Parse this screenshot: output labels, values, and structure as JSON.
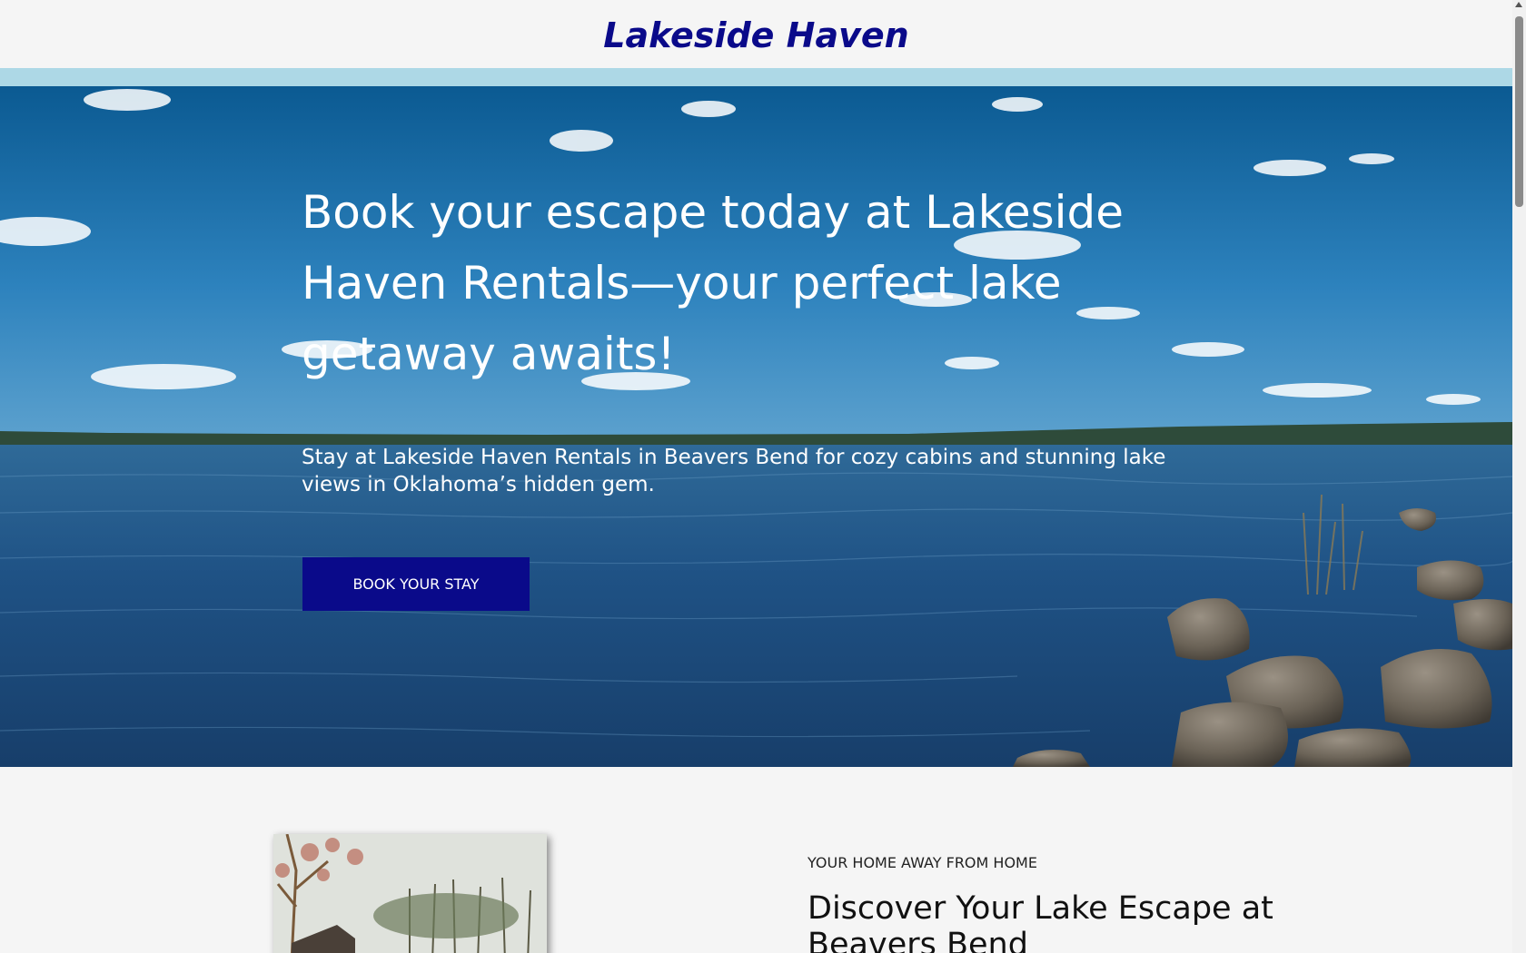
{
  "header": {
    "site_title": "Lakeside Haven"
  },
  "hero": {
    "heading": "Book your escape today at Lakeside Haven Rentals—your perfect lake getaway awaits!",
    "subheading": "Stay at Lakeside Haven Rentals in Beavers Bend for cozy cabins and stunning lake views in Oklahoma’s hidden gem.",
    "cta_label": "BOOK YOUR STAY",
    "background_image": "lake-with-rocks-and-clouds"
  },
  "intro": {
    "eyebrow": "YOUR HOME AWAY FROM HOME",
    "heading": "Discover Your Lake Escape at Beavers Bend",
    "photo": "cabin-among-trees"
  },
  "colors": {
    "brand": "#0a0a8a",
    "accent_strip": "#add8e6",
    "page_background": "#f5f5f5"
  }
}
